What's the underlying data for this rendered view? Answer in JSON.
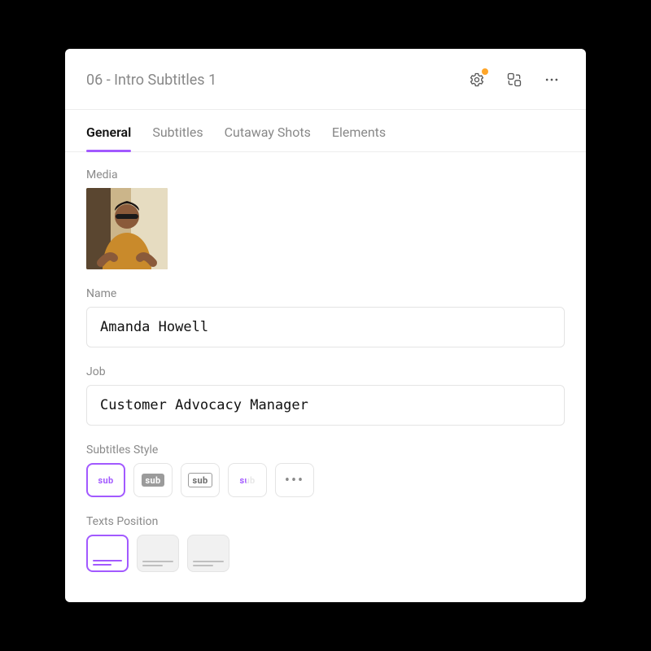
{
  "title": "06 - Intro Subtitles 1",
  "tabs": [
    {
      "label": "General",
      "active": true
    },
    {
      "label": "Subtitles",
      "active": false
    },
    {
      "label": "Cutaway Shots",
      "active": false
    },
    {
      "label": "Elements",
      "active": false
    }
  ],
  "labels": {
    "media": "Media",
    "name": "Name",
    "job": "Job",
    "subtitlesStyle": "Subtitles Style",
    "textsPosition": "Texts Position"
  },
  "fields": {
    "name": "Amanda Howell",
    "job": "Customer Advocacy Manager"
  },
  "subtitleStyles": {
    "glyph": "sub",
    "selectedIndex": 0,
    "count": 4
  },
  "textPositions": {
    "selectedIndex": 0,
    "count": 3
  },
  "colors": {
    "accent": "#a259ff",
    "badge": "#ffa629"
  }
}
